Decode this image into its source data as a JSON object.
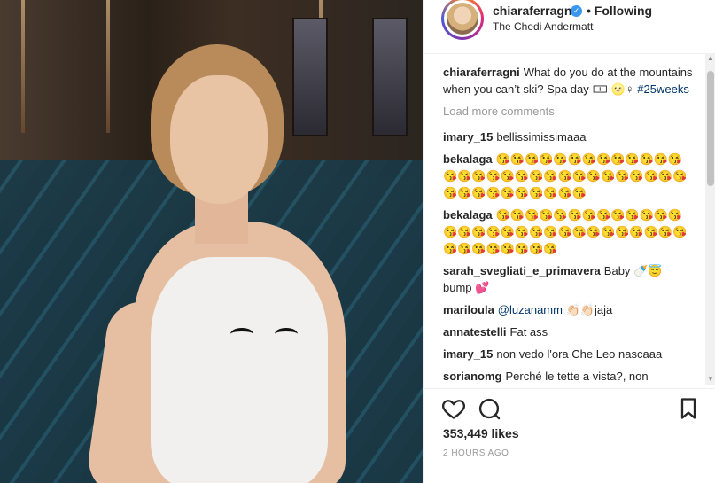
{
  "header": {
    "username": "chiaraferragni",
    "follow_status": "• Following",
    "location": "The Chedi Andermatt",
    "verified_glyph": "✓"
  },
  "caption": {
    "username": "chiaraferragni",
    "text": "What do you do at the mountains when you can’t ski? Spa day 🀱 🌝♀",
    "hashtag": "#25weeks"
  },
  "load_more": "Load more comments",
  "comments": [
    {
      "user": "imary_15",
      "text": "bellissimissimaaa"
    },
    {
      "user": "bekalaga",
      "text": "😘😘😘😘😘😘😘😘😘😘😘😘😘😘😘😘😘😘😘😘😘😘😘😘😘😘😘😘😘😘😘😘😘😘😘😘😘😘😘😘"
    },
    {
      "user": "bekalaga",
      "text": "😘😘😘😘😘😘😘😘😘😘😘😘😘😘😘😘😘😘😘😘😘😘😘😘😘😘😘😘😘😘😘😘😘😘😘😘😘😘"
    },
    {
      "user": "sarah_svegliati_e_primavera",
      "text": "Baby 🍼😇 bump 💕"
    },
    {
      "user": "mariloula",
      "mention": "@luzanamm",
      "text": " 👏🏻👏🏻jaja"
    },
    {
      "user": "annatestelli",
      "text": "Fat ass"
    },
    {
      "user": "imary_15",
      "text": "non vedo l'ora Che Leo nascaaa"
    },
    {
      "user": "sorianomg",
      "text": "Perché le tette a vista?, non"
    }
  ],
  "likes": "353,449 likes",
  "timestamp": "2 HOURS AGO",
  "icons": {
    "like": "heart-icon",
    "comment": "comment-icon",
    "save": "bookmark-icon"
  },
  "colors": {
    "link": "#003569",
    "verified": "#3897f0",
    "muted": "#999999"
  }
}
